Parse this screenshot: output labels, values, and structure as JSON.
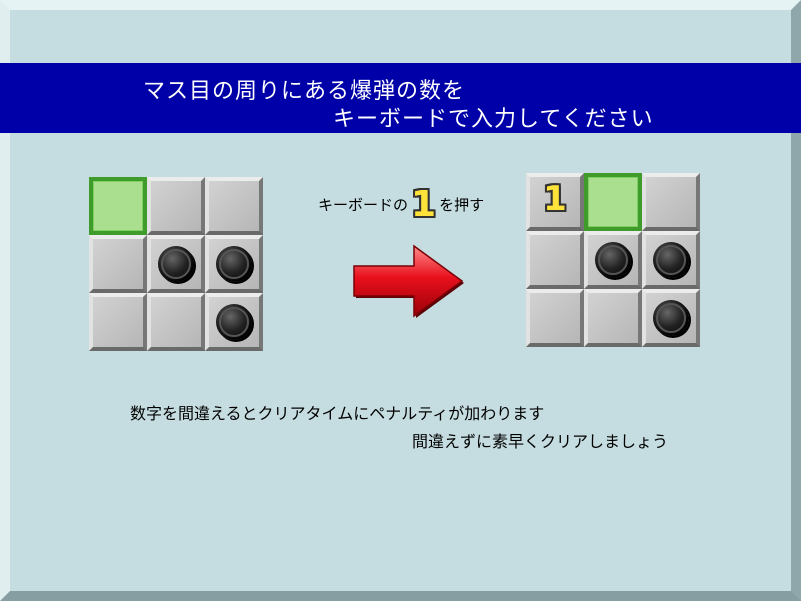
{
  "banner": {
    "line1": "マス目の周りにある爆弾の数を",
    "line2": "キーボードで入力してください"
  },
  "instruction": {
    "before": "キーボードの",
    "key": "1",
    "after": "を押す"
  },
  "before_grid": {
    "cells": [
      [
        "cursor",
        "empty",
        "empty"
      ],
      [
        "empty",
        "bomb",
        "bomb"
      ],
      [
        "empty",
        "empty",
        "bomb"
      ]
    ]
  },
  "after_grid": {
    "cells": [
      [
        "number",
        "cursor",
        "empty"
      ],
      [
        "empty",
        "bomb",
        "bomb"
      ],
      [
        "empty",
        "empty",
        "bomb"
      ]
    ],
    "revealed_number": "1"
  },
  "notes": {
    "line1": "数字を間違えるとクリアタイムにペナルティが加わります",
    "line2": "間違えずに素早くクリアしましょう"
  },
  "colors": {
    "banner": "#0000a8",
    "background": "#c5dde0",
    "cursor_fill": "#a9df8e",
    "cursor_border": "#3f9b2a",
    "arrow": "#e8101c",
    "number": "#ffe23a"
  }
}
